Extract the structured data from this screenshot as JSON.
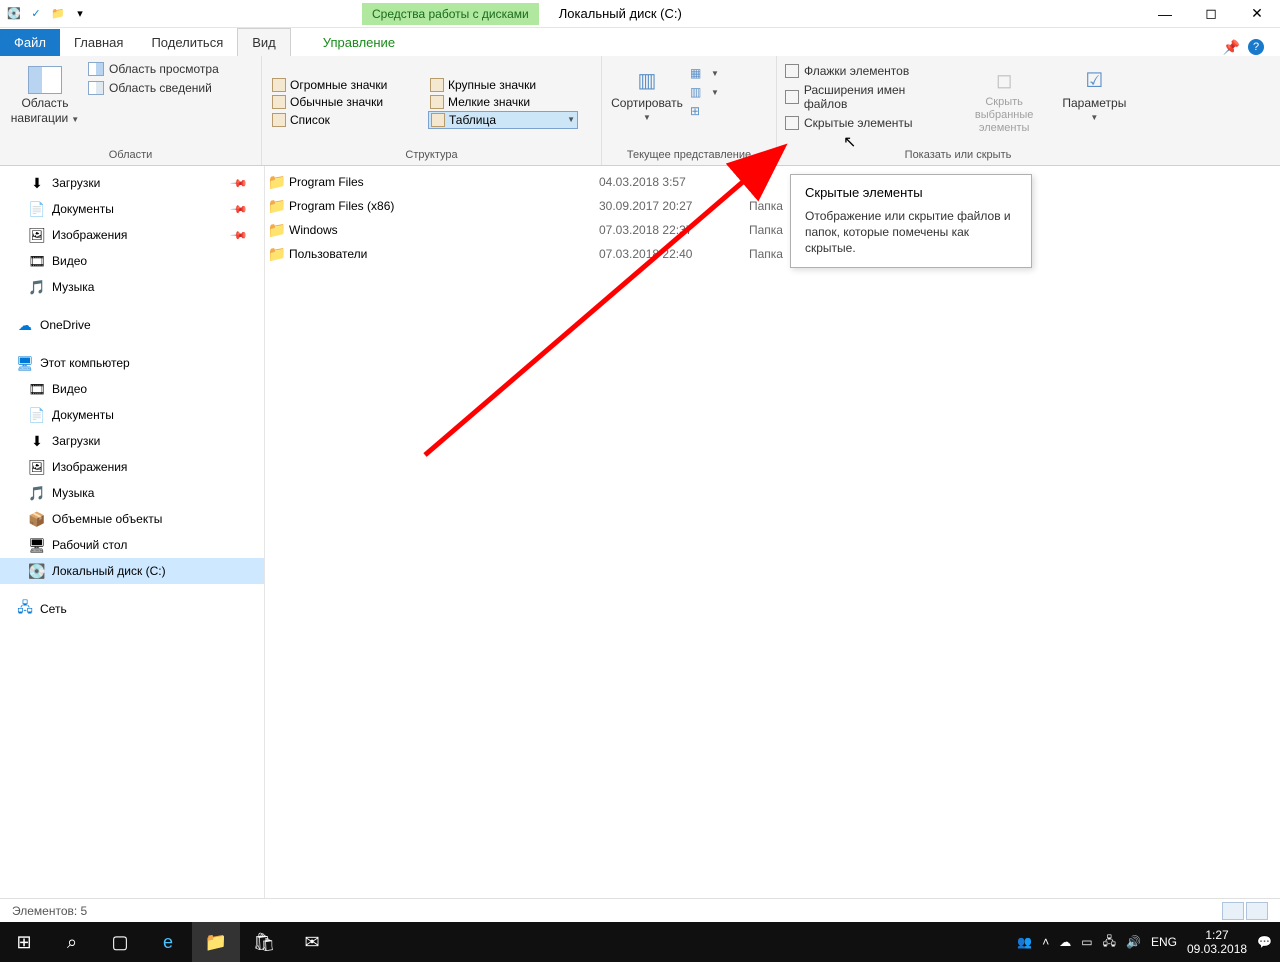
{
  "titlebar": {
    "drive_tools": "Средства работы с дисками",
    "title": "Локальный диск (C:)"
  },
  "tabs": {
    "file": "Файл",
    "home": "Главная",
    "share": "Поделиться",
    "view": "Вид",
    "manage": "Управление"
  },
  "ribbon": {
    "panes": {
      "nav": "Область навигации",
      "preview": "Область просмотра",
      "details": "Область сведений",
      "group": "Области"
    },
    "layout": {
      "huge": "Огромные значки",
      "large": "Крупные значки",
      "normal": "Обычные значки",
      "small": "Мелкие значки",
      "list": "Список",
      "table": "Таблица",
      "group": "Структура"
    },
    "sort": {
      "label": "Сортировать",
      "group": "Текущее представление"
    },
    "show": {
      "checkboxes": "Флажки элементов",
      "extensions": "Расширения имен файлов",
      "hidden": "Скрытые элементы",
      "hide_btn": "Скрыть выбранные элементы",
      "options": "Параметры",
      "group": "Показать или скрыть"
    }
  },
  "tooltip": {
    "title": "Скрытые элементы",
    "body": "Отображение или скрытие файлов и папок, которые помечены как скрытые."
  },
  "sidebar": {
    "quick": [
      {
        "icon": "⬇",
        "label": "Загрузки",
        "pin": true
      },
      {
        "icon": "📄",
        "label": "Документы",
        "pin": true
      },
      {
        "icon": "🖼",
        "label": "Изображения",
        "pin": true
      },
      {
        "icon": "🎞",
        "label": "Видео"
      },
      {
        "icon": "🎵",
        "label": "Музыка"
      }
    ],
    "onedrive": "OneDrive",
    "thispc": "Этот компьютер",
    "pc": [
      {
        "icon": "🎞",
        "label": "Видео"
      },
      {
        "icon": "📄",
        "label": "Документы"
      },
      {
        "icon": "⬇",
        "label": "Загрузки"
      },
      {
        "icon": "🖼",
        "label": "Изображения"
      },
      {
        "icon": "🎵",
        "label": "Музыка"
      },
      {
        "icon": "📦",
        "label": "Объемные объекты"
      },
      {
        "icon": "🖥",
        "label": "Рабочий стол"
      },
      {
        "icon": "💽",
        "label": "Локальный диск (C:)",
        "sel": true
      }
    ],
    "network": "Сеть"
  },
  "files": [
    {
      "name": "Program Files",
      "date": "04.03.2018 3:57",
      "type": ""
    },
    {
      "name": "Program Files (x86)",
      "date": "30.09.2017 20:27",
      "type": "Папка"
    },
    {
      "name": "Windows",
      "date": "07.03.2018 22:37",
      "type": "Папка"
    },
    {
      "name": "Пользователи",
      "date": "07.03.2018 22:40",
      "type": "Папка"
    }
  ],
  "status": {
    "items": "Элементов: 5"
  },
  "taskbar": {
    "lang": "ENG",
    "time": "1:27",
    "date": "09.03.2018"
  }
}
